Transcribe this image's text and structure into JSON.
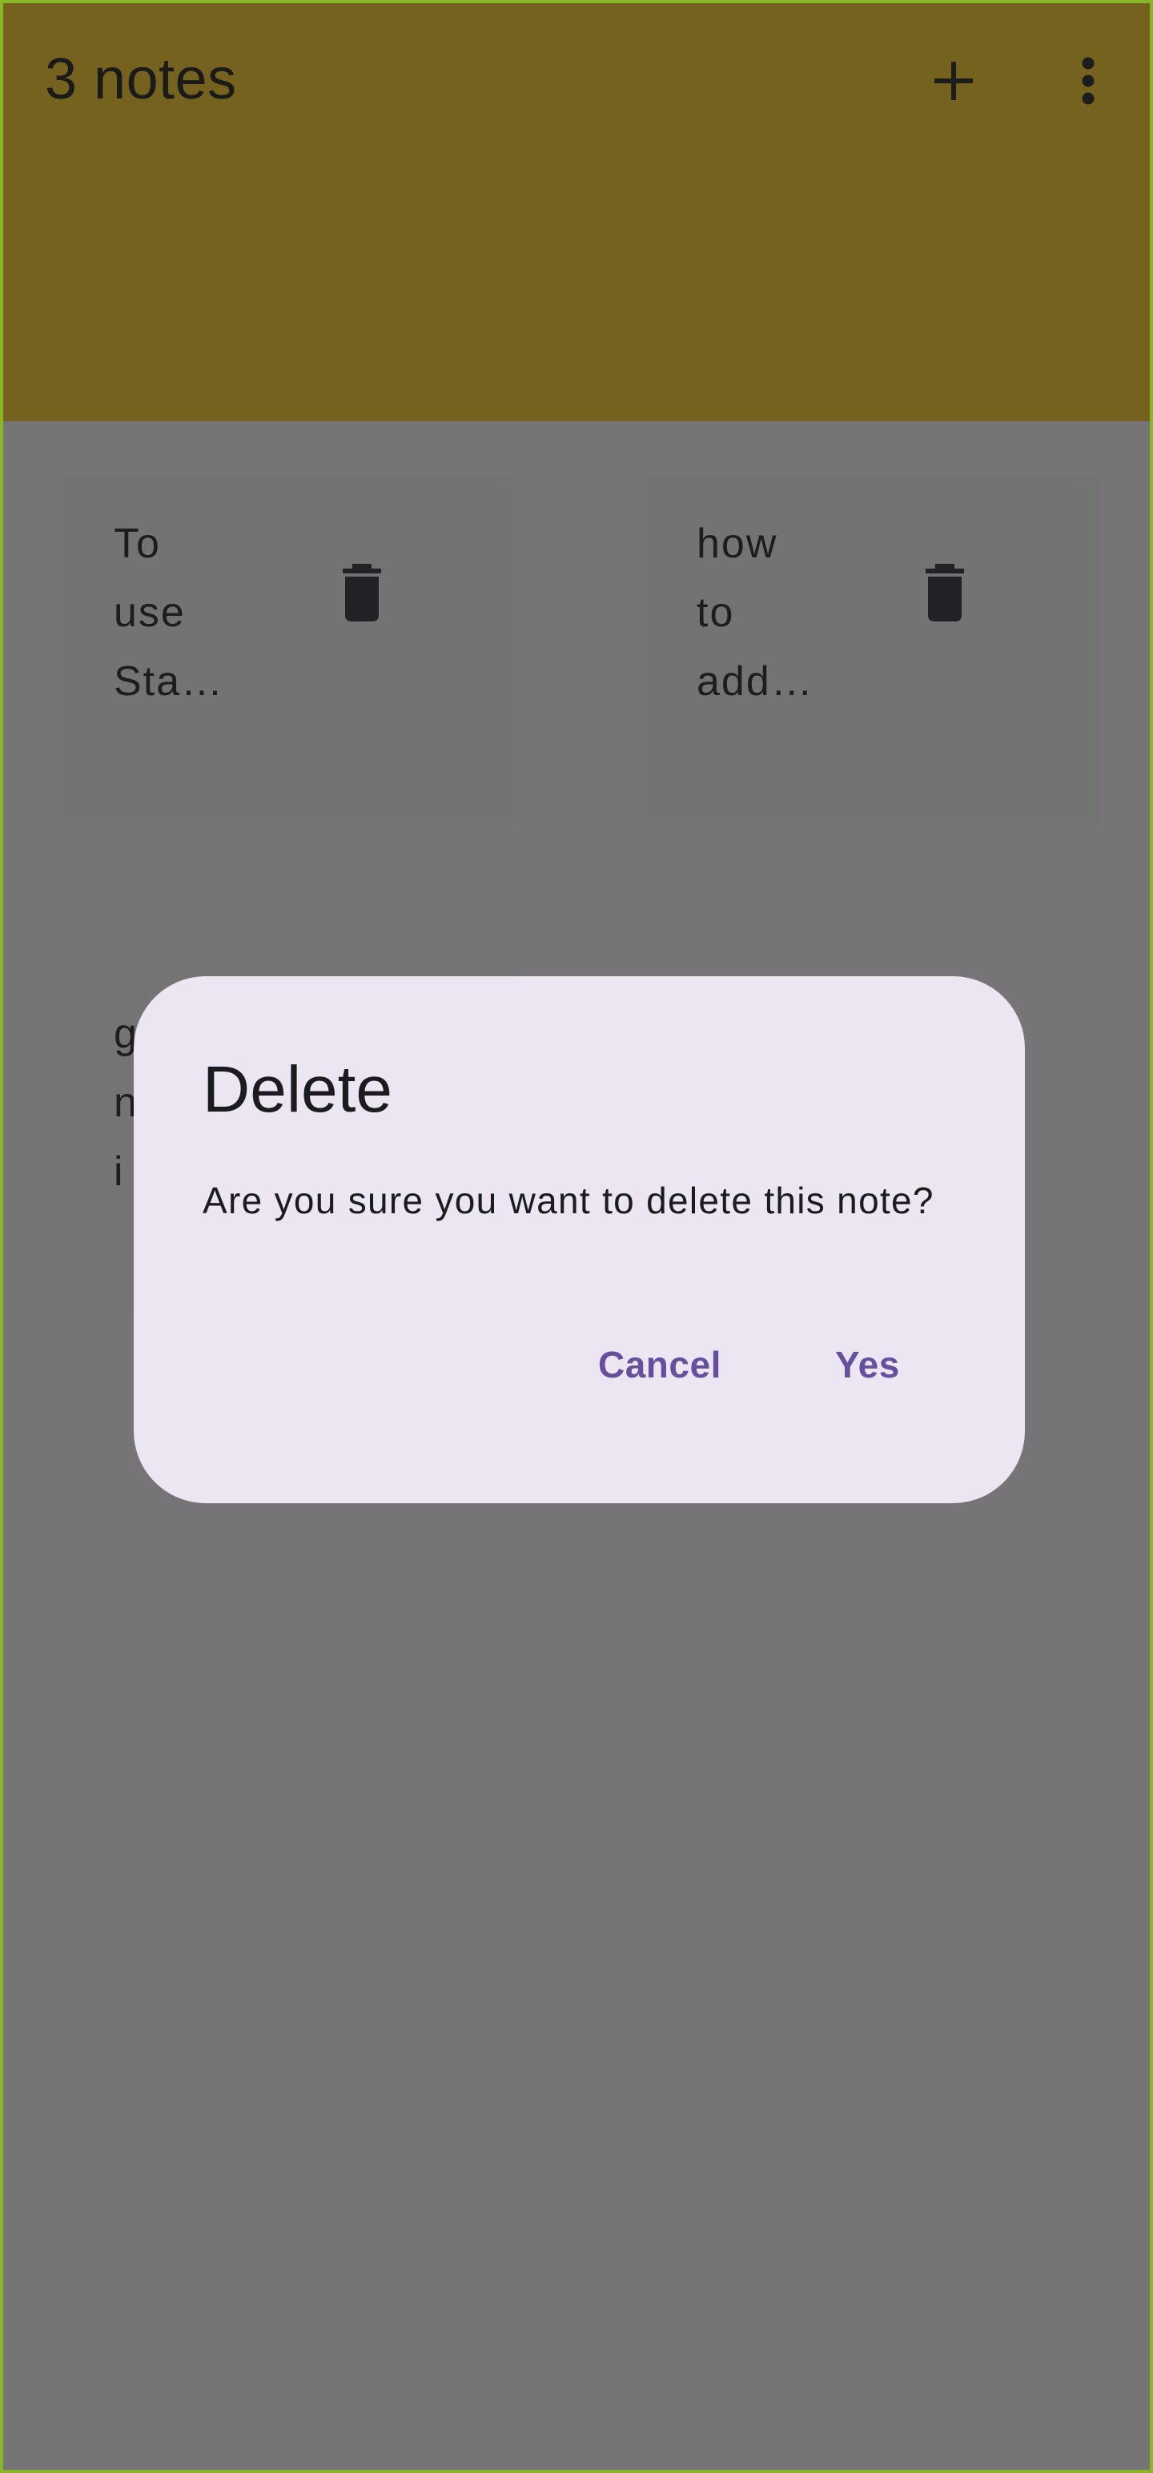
{
  "app_bar": {
    "title": "3 notes",
    "add_icon": "plus-icon",
    "more_icon": "more-vert-icon",
    "color": "#74621e"
  },
  "notes": [
    {
      "text": "To\nuse\nSta…",
      "delete_icon": "trash-icon"
    },
    {
      "text": "how\nto\nadd…",
      "delete_icon": "trash-icon"
    },
    {
      "text": "g\nn\ni",
      "delete_icon": "trash-icon"
    }
  ],
  "dialog": {
    "title": "Delete",
    "message": "Are you sure you want to delete this note?",
    "cancel_label": "Cancel",
    "confirm_label": "Yes",
    "accent_color": "#654f9e",
    "background": "#ece6f2"
  },
  "scrim_color": "#777477"
}
